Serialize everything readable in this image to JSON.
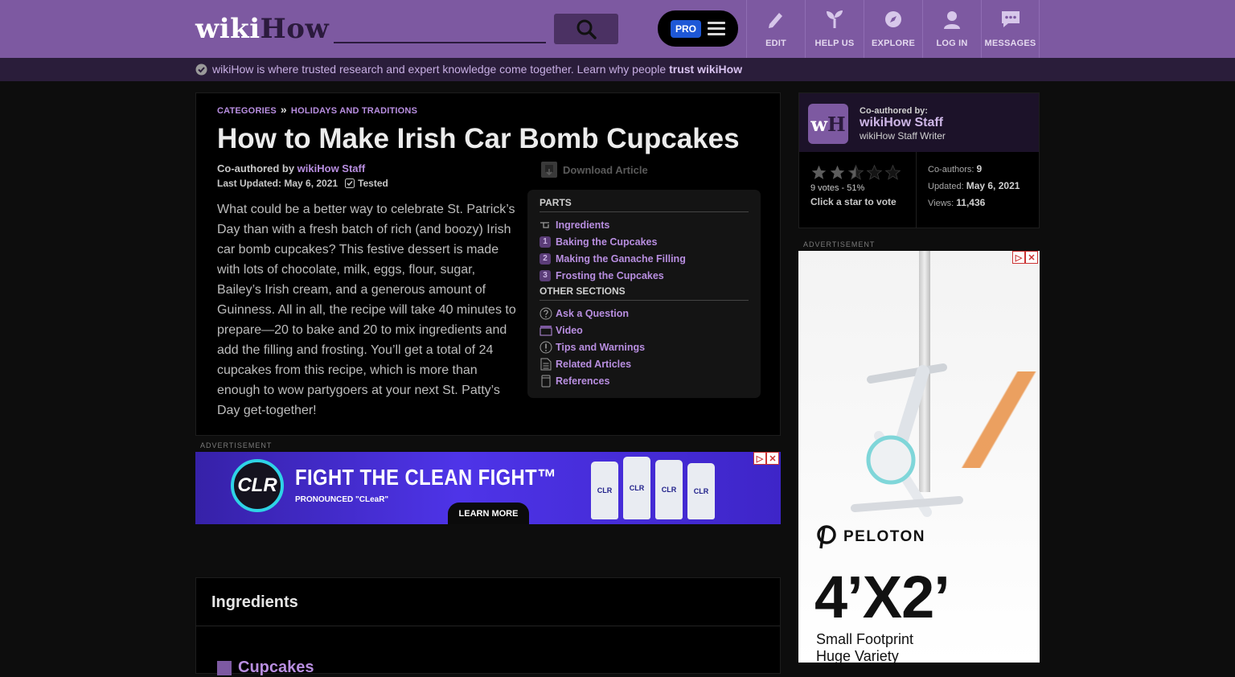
{
  "header": {
    "logo_wiki": "wiki",
    "logo_how": "How",
    "search_placeholder": "",
    "pro_label": "PRO",
    "nav": [
      {
        "label": "EDIT",
        "icon": "pencil-icon"
      },
      {
        "label": "HELP US",
        "icon": "sprout-icon"
      },
      {
        "label": "EXPLORE",
        "icon": "compass-icon"
      },
      {
        "label": "LOG IN",
        "icon": "user-icon"
      },
      {
        "label": "MESSAGES",
        "icon": "chat-icon"
      }
    ]
  },
  "trust": {
    "text": "wikiHow is where trusted research and expert knowledge come together. Learn why people ",
    "link": "trust wikiHow"
  },
  "article": {
    "breadcrumb": [
      "CATEGORIES",
      "HOLIDAYS AND TRADITIONS"
    ],
    "breadcrumb_sep": "»",
    "title": "How to Make Irish Car Bomb Cupcakes",
    "coauthored_prefix": "Co-authored by ",
    "coauthored_name": "wikiHow Staff",
    "last_updated": "Last Updated: May 6, 2021",
    "tested": "Tested",
    "download": "Download Article",
    "intro": "What could be a better way to celebrate St. Patrick’s Day than with a fresh batch of rich (and boozy) Irish car bomb cupcakes? This festive dessert is made with lots of chocolate, milk, eggs, flour, sugar, Bailey’s Irish cream, and a generous amount of Guinness. All in all, the recipe will take 40 minutes to prepare—20 to bake and 20 to mix ingredients and add the filling and frosting. You’ll get a total of 24 cupcakes from this recipe, which is more than enough to wow partygoers at your next St. Patty’s Day get-together!"
  },
  "toc": {
    "parts_heading": "PARTS",
    "parts": [
      {
        "num": "",
        "label": "Ingredients"
      },
      {
        "num": "1",
        "label": "Baking the Cupcakes"
      },
      {
        "num": "2",
        "label": "Making the Ganache Filling"
      },
      {
        "num": "3",
        "label": "Frosting the Cupcakes"
      }
    ],
    "other_heading": "OTHER SECTIONS",
    "other": [
      {
        "label": "Ask a Question",
        "icon": "question-icon"
      },
      {
        "label": "Video",
        "icon": "video-icon"
      },
      {
        "label": "Tips and Warnings",
        "icon": "warning-icon"
      },
      {
        "label": "Related Articles",
        "icon": "document-icon"
      },
      {
        "label": "References",
        "icon": "references-icon"
      }
    ]
  },
  "ad_label": "ADVERTISEMENT",
  "banner_ad": {
    "logo": "CLR",
    "headline": "FIGHT THE CLEAN FIGHT™",
    "sub": "PRONOUNCED \"CLeaR\"",
    "cta": "LEARN MORE",
    "bottles": [
      "CLR",
      "CLR",
      "CLR",
      "CLR"
    ]
  },
  "ingredients": {
    "heading": "Ingredients",
    "subheading": "Cupcakes"
  },
  "sidebar": {
    "coauthored_label": "Co-authored by:",
    "author_name": "wikiHow Staff",
    "author_role": "wikiHow Staff Writer",
    "votes": "9 votes - 51%",
    "rating_stars": 2.5,
    "click_vote": "Click a star to vote",
    "coauthors_label": "Co-authors: ",
    "coauthors_value": "9",
    "updated_label": "Updated: ",
    "updated_value": "May 6, 2021",
    "views_label": "Views: ",
    "views_value": "11,436"
  },
  "side_ad": {
    "brand": "PELOTON",
    "big": "4’X2’",
    "line1": "Small Footprint",
    "line2": "Huge Variety"
  },
  "colors": {
    "brand_purple": "#7d59a1",
    "link_purple": "#b88ee0",
    "trust_bar": "#2a1d3a"
  }
}
